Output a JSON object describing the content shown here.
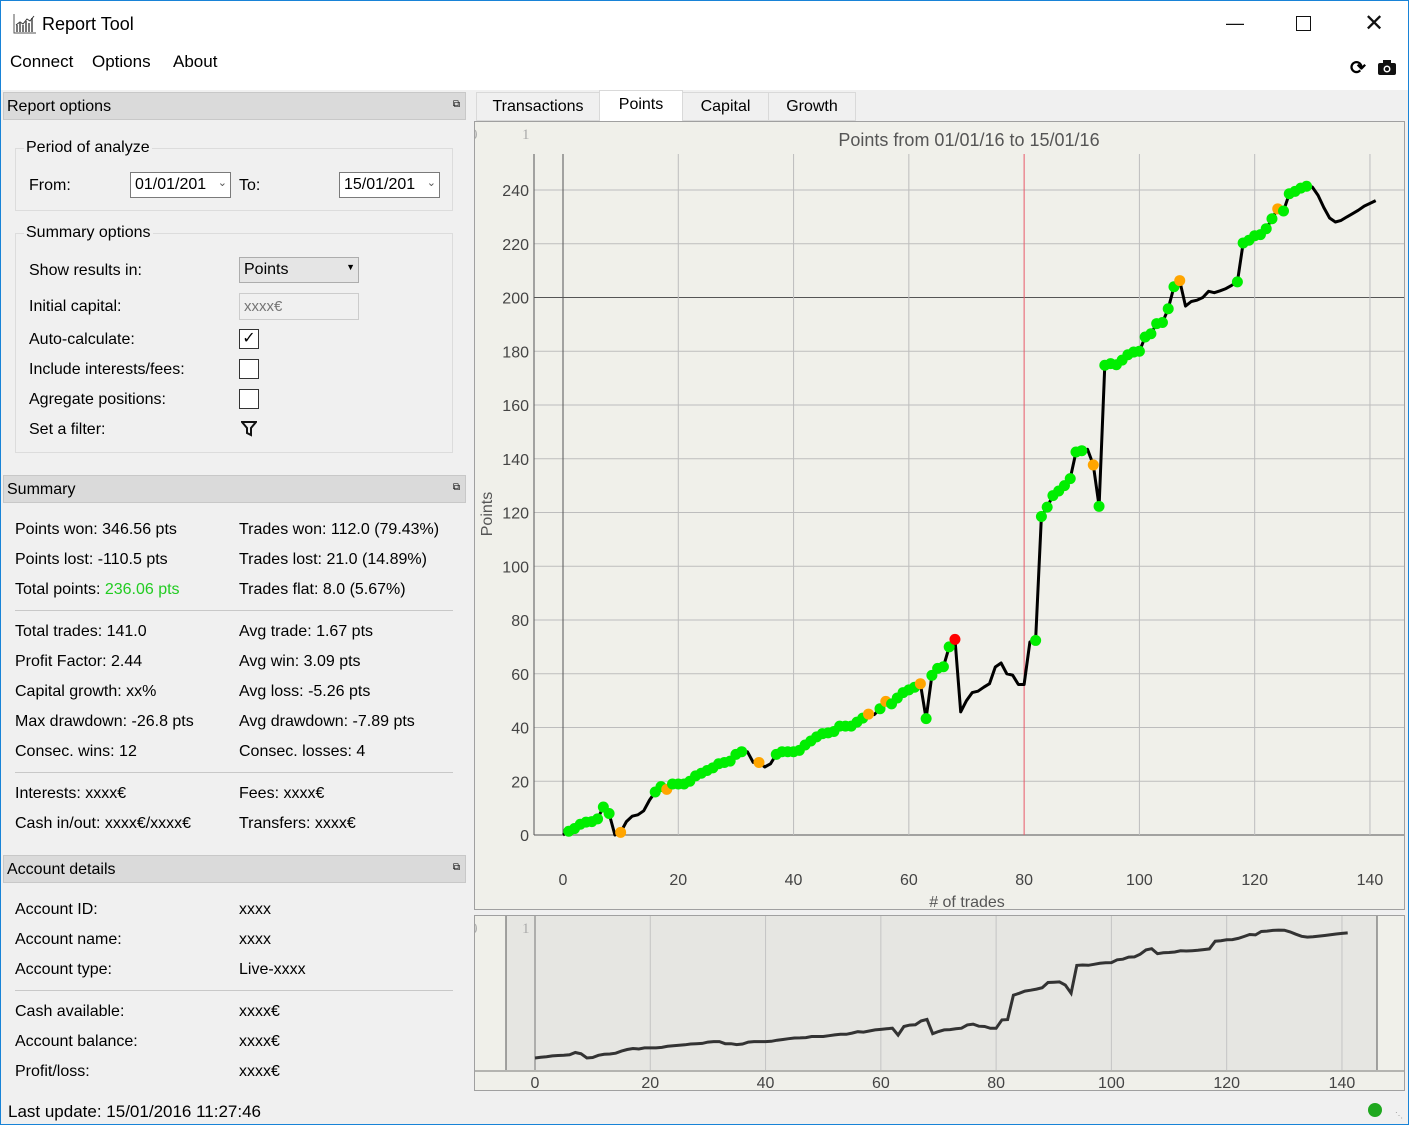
{
  "window": {
    "title": "Report Tool",
    "icon": "chart-app-icon",
    "controls": [
      "minimize-icon",
      "maximize-icon",
      "close-icon"
    ]
  },
  "menu": [
    "Connect",
    "Options",
    "About"
  ],
  "toolbar_icons": [
    "refresh-icon",
    "camera-icon"
  ],
  "report_options": {
    "header": "Report options",
    "period": {
      "title": "Period of analyze",
      "from_label": "From:",
      "from_value": "01/01/201",
      "to_label": "To:",
      "to_value": "15/01/201"
    },
    "summary_options": {
      "title": "Summary options",
      "show_results_label": "Show results in:",
      "show_results_value": "Points",
      "initial_capital_label": "Initial capital:",
      "initial_capital_placeholder": "xxxx€",
      "auto_calc_label": "Auto-calculate:",
      "auto_calc": true,
      "interests_label": "Include interests/fees:",
      "interests": false,
      "aggregate_label": "Agregate positions:",
      "aggregate": false,
      "filter_label": "Set a filter:"
    }
  },
  "summary": {
    "header": "Summary",
    "points_won": "Points won: 346.56 pts",
    "points_lost": "Points lost: -110.5 pts",
    "total_points_label": "Total points: ",
    "total_points_value": "236.06 pts",
    "total_points_color": "#22cc22",
    "trades_won": "Trades won: 112.0 (79.43%)",
    "trades_lost": "Trades lost: 21.0 (14.89%)",
    "trades_flat": "Trades flat: 8.0 (5.67%)",
    "total_trades": "Total trades: 141.0",
    "profit_factor": "Profit Factor: 2.44",
    "capital_growth": "Capital growth: xx%",
    "max_drawdown": "Max drawdown: -26.8 pts",
    "consec_wins": "Consec. wins: 12",
    "avg_trade": "Avg trade: 1.67 pts",
    "avg_win": "Avg win: 3.09 pts",
    "avg_loss": "Avg loss: -5.26 pts",
    "avg_drawdown": "Avg drawdown: -7.89 pts",
    "consec_losses": "Consec. losses: 4",
    "interests": "Interests: xxxx€",
    "cash_in_out": "Cash in/out: xxxx€/xxxx€",
    "fees": "Fees: xxxx€",
    "transfers": "Transfers: xxxx€"
  },
  "account": {
    "header": "Account details",
    "rows": [
      {
        "label": "Account ID:",
        "value": "xxxx"
      },
      {
        "label": "Account name:",
        "value": "xxxx"
      },
      {
        "label": "Account type:",
        "value": "Live-xxxx"
      },
      {
        "label": "Cash available:",
        "value": "xxxx€"
      },
      {
        "label": "Account balance:",
        "value": "xxxx€"
      },
      {
        "label": "Profit/loss:",
        "value": "xxxx€"
      }
    ]
  },
  "status": {
    "last_update": "Last update: 15/01/2016 11:27:46",
    "connection_color": "#1fa81f"
  },
  "tabs": [
    {
      "label": "Transactions"
    },
    {
      "label": "Points",
      "active": true
    },
    {
      "label": "Capital"
    },
    {
      "label": "Growth"
    }
  ],
  "chart_data": {
    "type": "line",
    "title": "Points from 01/01/16 to 15/01/16",
    "xlabel": "# of trades",
    "ylabel": "Points",
    "corner_labels": [
      "0",
      "1"
    ],
    "xlim": [
      -5,
      146
    ],
    "ylim": [
      -12,
      252
    ],
    "xticks": [
      0,
      20,
      40,
      60,
      80,
      100,
      120,
      140
    ],
    "yticks": [
      0,
      20,
      40,
      60,
      80,
      100,
      120,
      140,
      160,
      180,
      200,
      220,
      240
    ],
    "grid": true,
    "line_color": "#000000",
    "marker_colors": {
      "g": "#00ee00",
      "o": "#ffa500",
      "r": "#ff0000"
    },
    "y": [
      0,
      1.4,
      2.4,
      4,
      4.8,
      5,
      6,
      10.4,
      8,
      0,
      1,
      5,
      7,
      7.5,
      9,
      13,
      16,
      18,
      17,
      19,
      19,
      19,
      20,
      22,
      23,
      24,
      25,
      26.5,
      27,
      27.5,
      30,
      31,
      31,
      27,
      27,
      25.3,
      26.5,
      30,
      31,
      31,
      31,
      31.5,
      33.5,
      35,
      36.5,
      37.7,
      38,
      38.5,
      40.5,
      40.5,
      40.5,
      42,
      43.5,
      45,
      44.8,
      47,
      49.7,
      48.8,
      51,
      53,
      54,
      55,
      56.3,
      43.3,
      59.4,
      62,
      62.6,
      70,
      72.8,
      45.8,
      50,
      53,
      53.5,
      55,
      56.3,
      62.5,
      64,
      60,
      59.5,
      56,
      56,
      71.8,
      72.4,
      118.5,
      122,
      126.3,
      128,
      130,
      132.6,
      142.5,
      143,
      143.5,
      137.7,
      122.3,
      174.8,
      175.4,
      175,
      176.7,
      178.7,
      179.7,
      180,
      185.3,
      186.5,
      190.3,
      190.7,
      195.8,
      204,
      206.3,
      196.8,
      198.5,
      199,
      200,
      202.3,
      201.8,
      202.5,
      203.3,
      204.5,
      205.8,
      220.3,
      221.3,
      223,
      223.4,
      225.6,
      229.3,
      233,
      232.2,
      238.6,
      239.5,
      240.7,
      241.4,
      241.1,
      238,
      233.5,
      229.6,
      228.1,
      228.7,
      230,
      231.2,
      232.5,
      234,
      235,
      236.06
    ],
    "markers": "_gggggggg_o_____ggoggggggggggggg__o__ggggggggggggggggo_gogggggogggggr_____________ggggggggg_oggggggggggggggo_________gggggggoggggg___________"
  },
  "overview_chart": {
    "type": "line",
    "corner_labels": [
      "0",
      "1"
    ],
    "xticks": [
      0,
      20,
      40,
      60,
      80,
      100,
      120,
      140
    ],
    "line_color": "#333333"
  }
}
